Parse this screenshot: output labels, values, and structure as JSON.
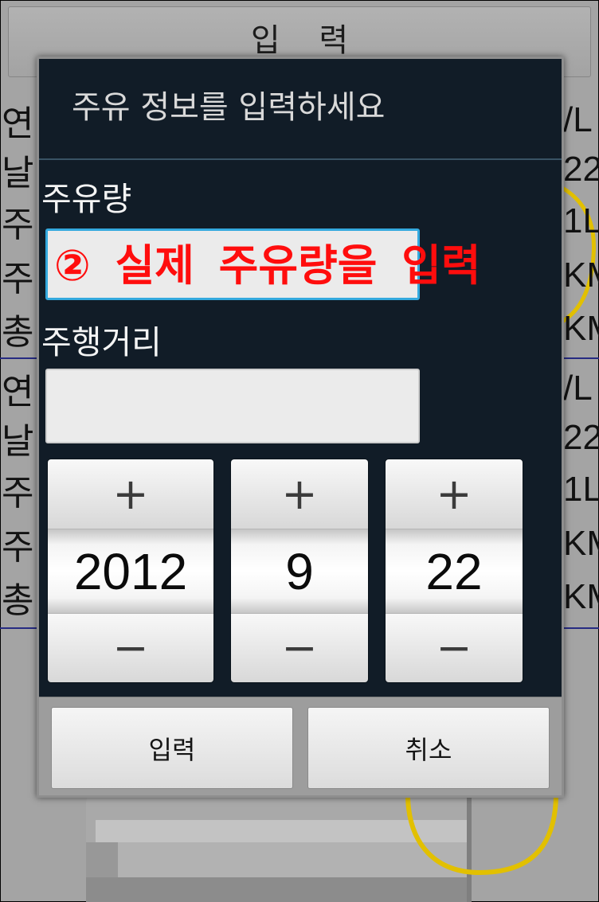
{
  "background_screen": {
    "top_button_label": "입 력",
    "row_groups": [
      {
        "left": [
          "연",
          "날",
          "주",
          "주",
          "총"
        ],
        "right": [
          "/L",
          "22",
          "1L",
          "KM",
          "KM"
        ]
      },
      {
        "left": [
          "연",
          "날",
          "주",
          "주",
          "총"
        ],
        "right": [
          "/L",
          "22",
          "1L",
          "KM",
          "KM"
        ]
      }
    ]
  },
  "dialog": {
    "title": "주유 정보를 입력하세요",
    "fuel_amount": {
      "label": "주유량",
      "value": ""
    },
    "distance": {
      "label": "주행거리",
      "value": ""
    },
    "date_picker": {
      "increment_symbol": "+",
      "decrement_symbol": "−",
      "year": "2012",
      "month": "9",
      "day": "22"
    },
    "buttons": {
      "confirm": "입력",
      "cancel": "취소"
    }
  },
  "annotation": {
    "text": "② 실제 주유량을 입력"
  },
  "colors": {
    "dialog_background": "#111c27",
    "input_focus_border": "#34a9de",
    "annotation_text": "#ff0d0d",
    "list_separator": "#262b82",
    "hose_yellow": "#e2c000"
  },
  "icons": {
    "increment": "plus-icon",
    "decrement": "minus-icon"
  }
}
